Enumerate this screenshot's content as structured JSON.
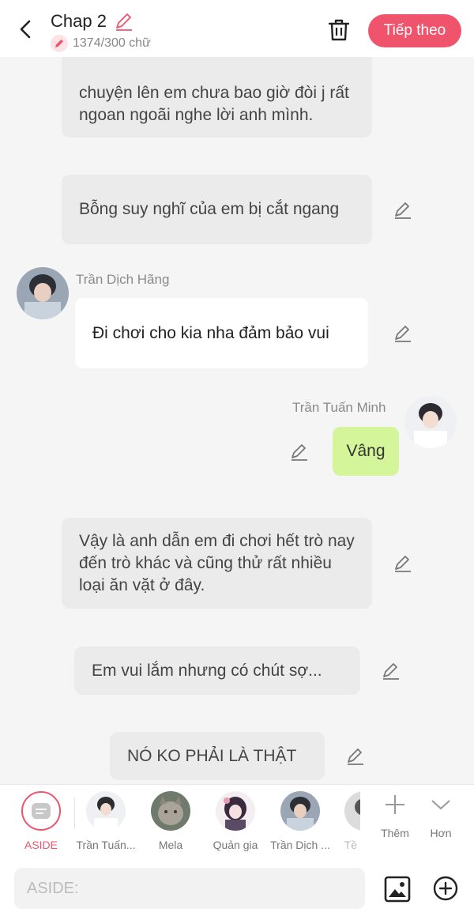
{
  "header": {
    "title": "Chap 2",
    "word_count": "1374/300 chữ",
    "next_label": "Tiếp theo"
  },
  "messages": {
    "m1": "chuyện lên em chưa bao giờ đòi j rất ngoan ngoãi nghe lời anh mình.",
    "m2": "Bỗng suy nghĩ  của em bị cắt ngang",
    "m3_name": "Trần Dịch Hãng",
    "m3": "Đi chơi cho kia nha đảm bảo vui",
    "m4_name": "Trần Tuấn Minh",
    "m4": "Vâng",
    "m5": "Vậy là anh dẫn em đi chơi hết trò nay đến trò khác và cũng thử rất nhiều loại ăn vặt ở đây.",
    "m6": "Em vui lắm nhưng có chút sợ...",
    "m7": "NÓ KO PHẢI LÀ THẬT"
  },
  "character_bar": {
    "aside": "ASIDE",
    "chars": [
      "Trần Tuấn...",
      "Mela",
      "Quản gia",
      "Trần Dịch ...",
      "Tề"
    ],
    "more_label": "Thêm",
    "collapse_label": "Hơn"
  },
  "input": {
    "placeholder": "ASIDE:"
  },
  "colors": {
    "accent": "#f0546d",
    "narration_bg": "#ebebeb",
    "self_bubble": "#d4f59a",
    "other_bubble": "#ffffff"
  }
}
